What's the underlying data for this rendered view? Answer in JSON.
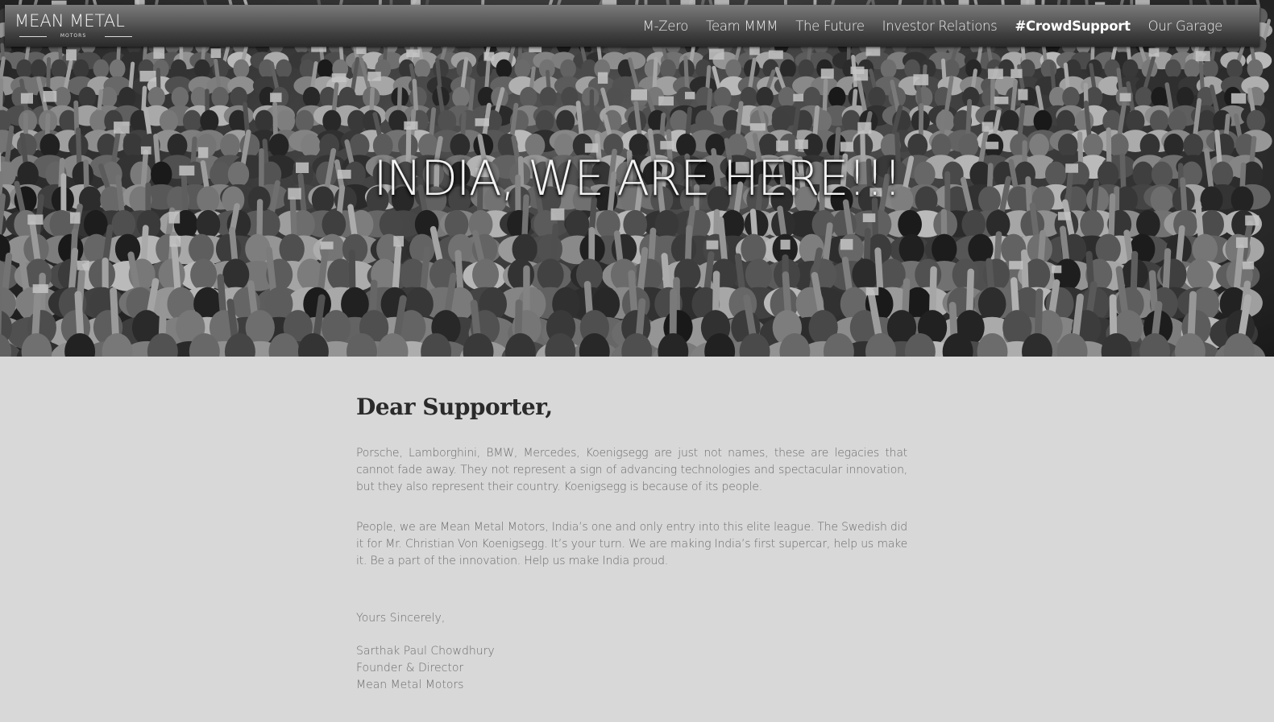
{
  "nav": {
    "logo": {
      "main": "MEAN METAL",
      "sub": "MOTORS"
    },
    "items": [
      {
        "label": "M-Zero",
        "active": false
      },
      {
        "label": "Team MMM",
        "active": false
      },
      {
        "label": "The Future",
        "active": false
      },
      {
        "label": "Investor Relations",
        "active": false
      },
      {
        "label": "#CrowdSupport",
        "active": true
      },
      {
        "label": "Our Garage",
        "active": false
      }
    ]
  },
  "hero": {
    "title": "INDIA, WE ARE HERE!!!"
  },
  "letter": {
    "greeting": "Dear Supporter,",
    "paragraph1": "Porsche, Lamborghini, BMW, Mercedes, Koenigsegg are just not names, these are legacies that cannot fade away. They not represent a sign of advancing technologies and spectacular innovation, but they also represent their country. Koenigsegg is because of its people.",
    "paragraph2": "People, we are Mean Metal Motors, India’s one and only entry into this elite league. The Swedish did it for Mr. Christian Von Koenigsegg. It’s your turn. We are making India’s first supercar, help us make it. Be a part of the innovation. Help us make India proud.",
    "closing": "Yours Sincerely,",
    "signature": {
      "name": "Sarthak Paul Chowdhury",
      "title": "Founder & Director",
      "company": "Mean Metal Motors"
    }
  },
  "colors": {
    "page_bg": "#d8d8d8",
    "text": "#6d6d6d",
    "heading": "#2a2a2a"
  }
}
